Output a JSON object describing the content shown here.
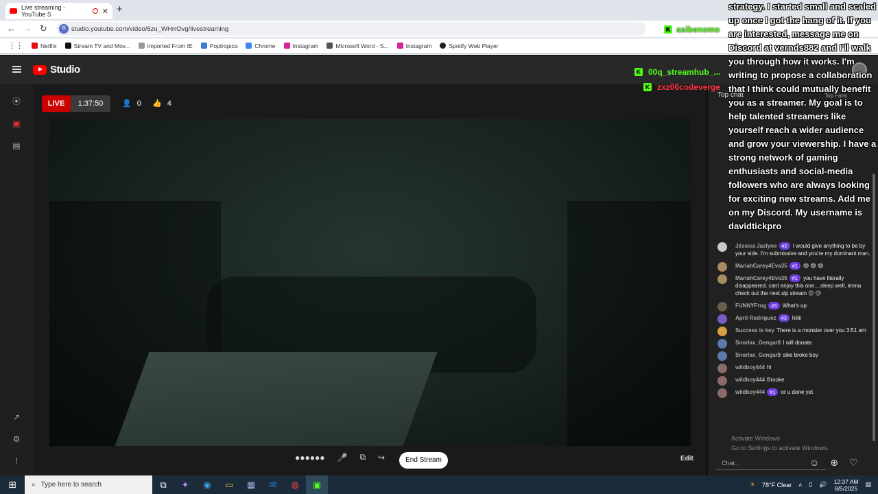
{
  "browser": {
    "tab_title": "Live streaming - YouTube S",
    "url": "studio.youtube.com/video/6zu_WHrrOvg/livestreaming",
    "bookmarks": [
      "Netflix",
      "Stream TV and Mov...",
      "Imported From IE",
      "Poptropica",
      "Chrome",
      "Instagram",
      "Microsoft Word - S...",
      "Instagram",
      "Spotify Web Player"
    ]
  },
  "overlay": {
    "kick_user_1": "asibenomo",
    "kick_user_2": "00q_streamhub_...",
    "kick_user_3": "zxz06codeverge",
    "spam_text": "strategy. I started small and scaled up once I got the hang of it. If you are interested, message me on Discord at vernds882 and I'll walk you through how it works. I'm writing to propose a collaboration that I think could mutually benefit you as a streamer. My goal is to help talented streamers like yourself reach a wider audience and grow your viewership. I have a strong network of gaming enthusiasts and social-media followers who are always looking for exciting new streams. Add me on my Discord. My username is davidtickpro"
  },
  "studio": {
    "brand": "Studio",
    "live_label": "LIVE",
    "timer": "1:37:50",
    "viewers": "0",
    "likes": "4",
    "end_stream": "End Stream",
    "edit": "Edit"
  },
  "chat": {
    "header": "Top chat",
    "top_fans": "Top Fans",
    "input_placeholder": "Chat...",
    "messages": [
      {
        "name": "Jéssica Jaslyne",
        "badge": "#2",
        "text": "I would give anything to be by your side. I'm submissive and you're my dominant man."
      },
      {
        "name": "MariahCarey4Eva35",
        "badge": "#1",
        "text": "😄 😄 😄"
      },
      {
        "name": "MariahCarey4Eva35",
        "badge": "#1",
        "text": "you have literally disappeared. cant enjoy this one....sleep well, imma check out the next slp stream 😕 😕"
      },
      {
        "name": "FUNNYFrog",
        "badge": "#3",
        "text": "What's up"
      },
      {
        "name": "April Rodriguez",
        "badge": "#3",
        "text": "hiiiii"
      },
      {
        "name": "Success is key",
        "badge": "",
        "text": "There is a monster over you 3:51 am"
      },
      {
        "name": "Snorlax_Gengar8",
        "badge": "",
        "text": "I will donate"
      },
      {
        "name": "Snorlax_Gengar8",
        "badge": "",
        "text": "sike broke boy"
      },
      {
        "name": "wildboy444",
        "badge": "",
        "text": "hi"
      },
      {
        "name": "wildboy444",
        "badge": "",
        "text": "Brooke"
      },
      {
        "name": "wildboy444",
        "badge": "#1",
        "text": "or u done yet"
      }
    ],
    "avatar_colors": [
      "#c9c9c9",
      "#a78a62",
      "#a78a62",
      "#6b5b4a",
      "#7b5cc4",
      "#d8a040",
      "#5a7aa8",
      "#5a7aa8",
      "#8a6a6a",
      "#8a6a6a",
      "#8a6a6a"
    ]
  },
  "watermark": {
    "line1": "Activate Windows",
    "line2": "Go to Settings to activate Windows."
  },
  "taskbar": {
    "search": "Type here to search",
    "weather": "78°F Clear",
    "time": "12:37 AM",
    "date": "8/5/2025"
  }
}
